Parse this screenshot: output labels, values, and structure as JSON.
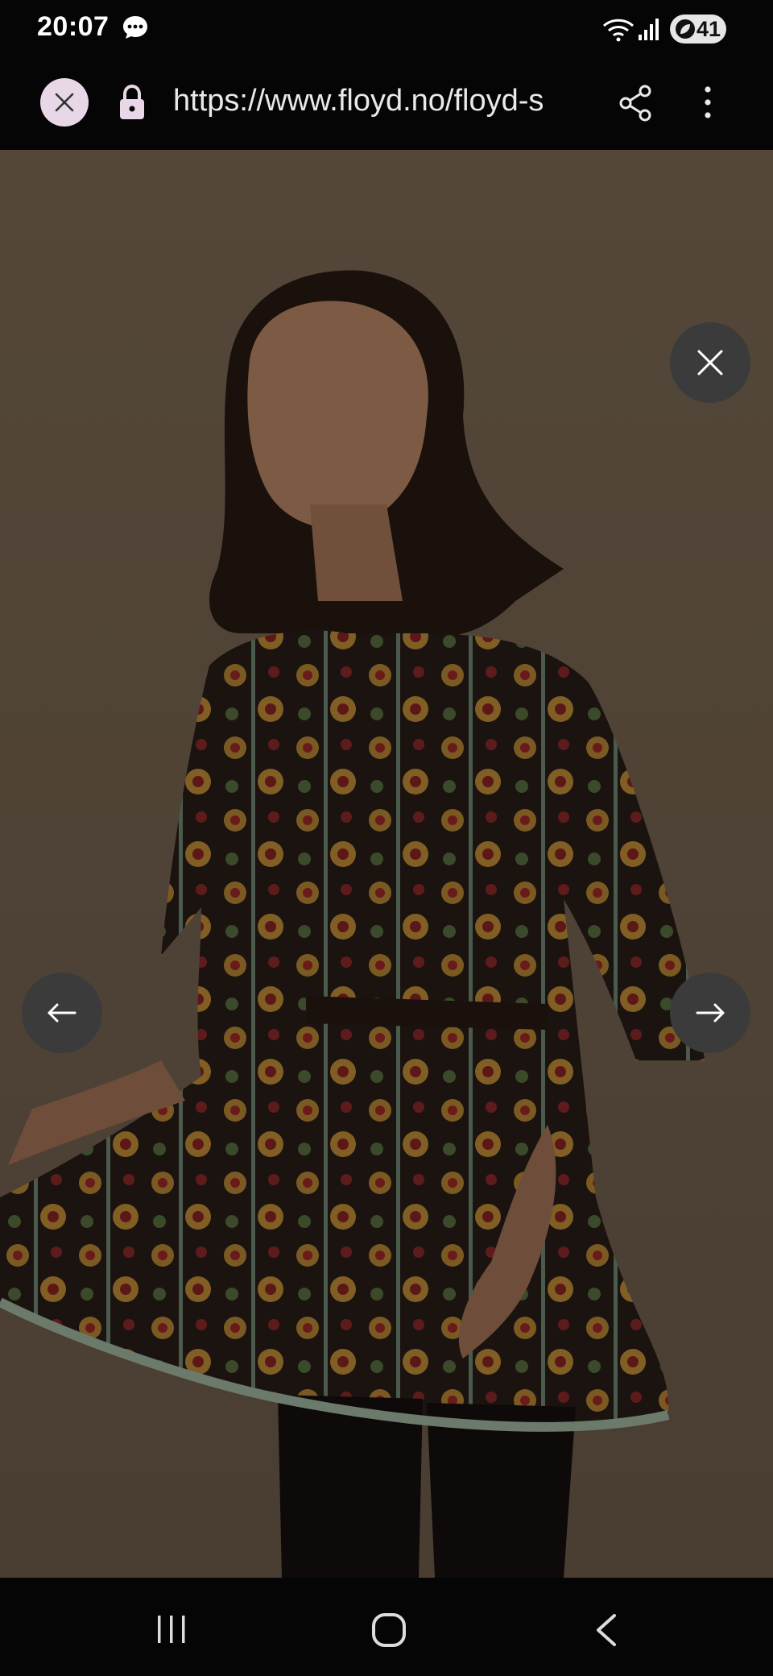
{
  "status_bar": {
    "time": "20:07",
    "battery": "41",
    "icons": [
      "message-icon",
      "wifi-icon",
      "signal-icon",
      "battery-saver-icon"
    ]
  },
  "browser": {
    "url": "https://www.floyd.no/floyd-s",
    "icons": [
      "close-icon",
      "lock-icon",
      "share-icon",
      "more-vertical-icon"
    ],
    "close_button_color": "#e8d7e6"
  },
  "image_viewer": {
    "image_description_icon": "product-photo",
    "backdrop_color": "#4e4239",
    "controls": [
      "close-icon",
      "arrow-left-icon",
      "arrow-right-icon"
    ],
    "control_color": "#3b3b3b"
  },
  "nav_bar": {
    "icons": [
      "recent-apps-icon",
      "home-icon",
      "back-icon"
    ]
  }
}
